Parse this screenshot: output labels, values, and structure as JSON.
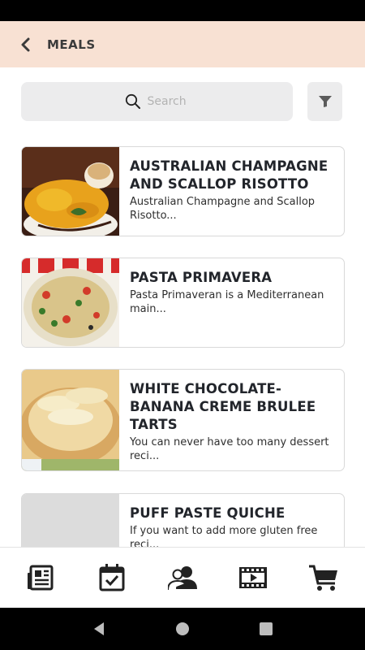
{
  "header": {
    "title": "MEALS",
    "back_icon": "chevron-left-icon"
  },
  "search": {
    "placeholder": "Search",
    "value": ""
  },
  "meals": [
    {
      "title": "AUSTRALIAN CHAMPAGNE AND SCALLOP RISOTTO",
      "description": "Australian Champagne and Scallop Risotto..."
    },
    {
      "title": "PASTA PRIMAVERA",
      "description": "Pasta Primaveran is a Mediterranean main..."
    },
    {
      "title": "WHITE CHOCOLATE-BANANA CREME BRULEE TARTS",
      "description": "You can never have too many dessert reci..."
    },
    {
      "title": "PUFF PASTE QUICHE",
      "description": "If you want to add more gluten free reci..."
    }
  ],
  "bottom_nav": [
    "newspaper-icon",
    "calendar-check-icon",
    "users-icon",
    "film-icon",
    "cart-icon"
  ],
  "colors": {
    "header_bg": "#f8e1d3",
    "text_dark": "#22252b",
    "search_bg": "#ececed"
  }
}
